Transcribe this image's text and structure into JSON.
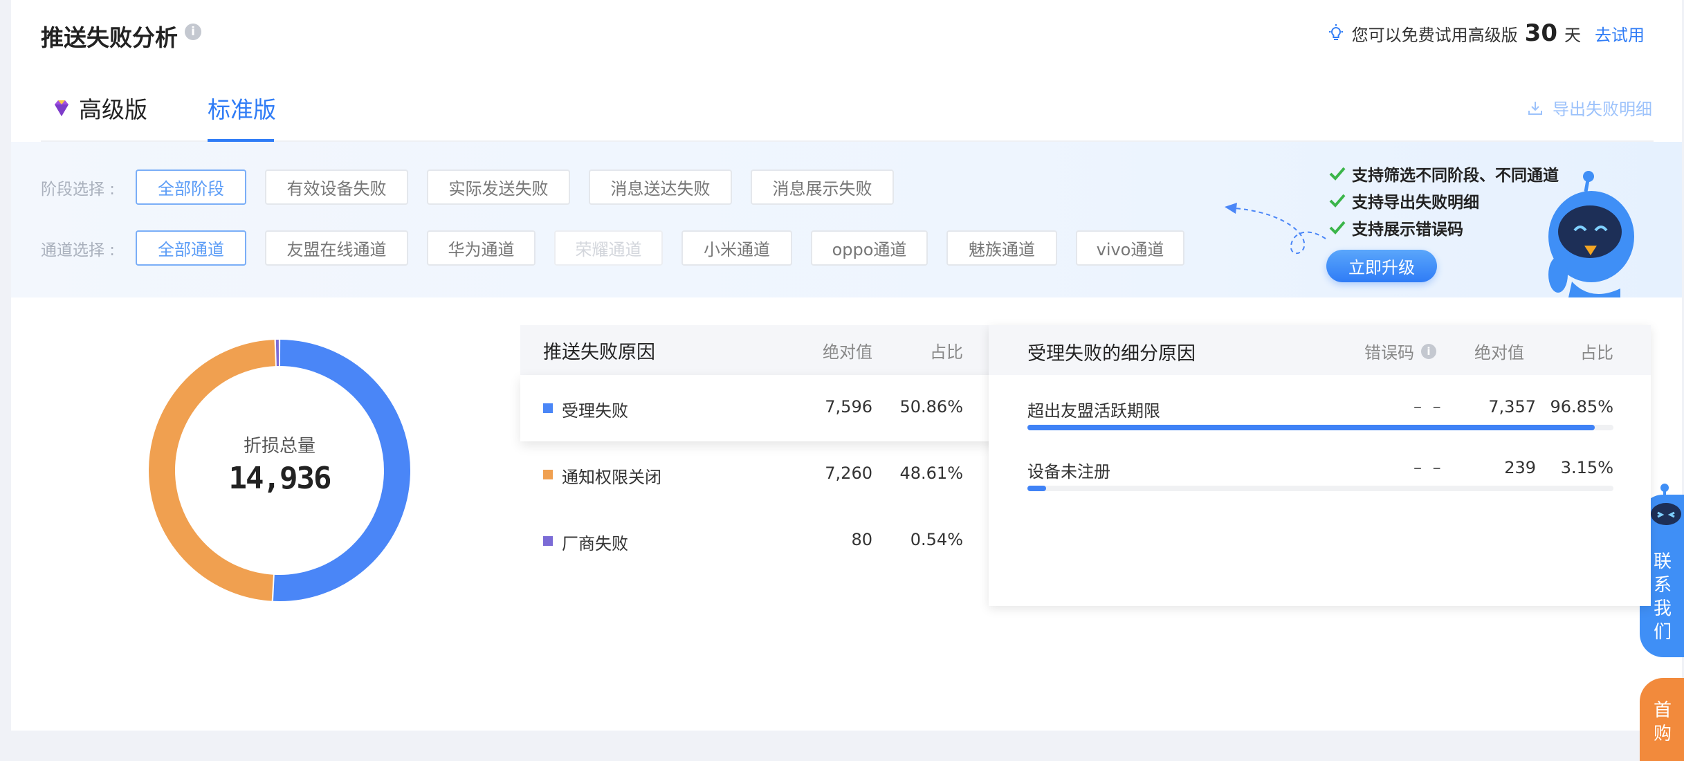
{
  "header": {
    "title": "推送失败分析",
    "trial_text": "您可以免费试用高级版",
    "trial_days": "30",
    "trial_unit": "天",
    "trial_link": "去试用"
  },
  "tabs": [
    {
      "label": "高级版",
      "active": false
    },
    {
      "label": "标准版",
      "active": true
    }
  ],
  "export_label": "导出失败明细",
  "filters": {
    "stage_label": "阶段选择 :",
    "stages": [
      "全部阶段",
      "有效设备失败",
      "实际发送失败",
      "消息送达失败",
      "消息展示失败"
    ],
    "channel_label": "通道选择 :",
    "channels": [
      "全部通道",
      "友盟在线通道",
      "华为通道",
      "荣耀通道",
      "小米通道",
      "oppo通道",
      "魅族通道",
      "vivo通道"
    ]
  },
  "promo": {
    "perks": [
      "支持筛选不同阶段、不同通道",
      "支持导出失败明细",
      "支持展示错误码"
    ],
    "upgrade_button": "立即升级"
  },
  "donut": {
    "label": "折损总量",
    "total": "14,936"
  },
  "chart_data": {
    "type": "pie",
    "title": "折损总量",
    "total": 14936,
    "slices": [
      {
        "name": "受理失败",
        "value": 7596,
        "percent": 50.86,
        "color": "#4a86f7"
      },
      {
        "name": "通知权限关闭",
        "value": 7260,
        "percent": 48.61,
        "color": "#f0a050"
      },
      {
        "name": "厂商失败",
        "value": 80,
        "percent": 0.54,
        "color": "#7b6bd6"
      }
    ]
  },
  "reasons_table": {
    "headers": [
      "推送失败原因",
      "绝对值",
      "占比"
    ],
    "rows": [
      {
        "name": "受理失败",
        "value": "7,596",
        "percent": "50.86%",
        "color": "#4a86f7",
        "selected": true
      },
      {
        "name": "通知权限关闭",
        "value": "7,260",
        "percent": "48.61%",
        "color": "#f0a050",
        "selected": false
      },
      {
        "name": "厂商失败",
        "value": "80",
        "percent": "0.54%",
        "color": "#7b6bd6",
        "selected": false
      }
    ]
  },
  "detail_table": {
    "headers": [
      "受理失败的细分原因",
      "错误码",
      "绝对值",
      "占比"
    ],
    "rows": [
      {
        "name": "超出友盟活跃期限",
        "code": "– –",
        "value": "7,357",
        "percent": "96.85%",
        "share": 0.9685
      },
      {
        "name": "设备未注册",
        "code": "– –",
        "value": "239",
        "percent": "3.15%",
        "share": 0.0315
      }
    ]
  },
  "side": {
    "contact": "联系我们",
    "home": "首购"
  },
  "colors": {
    "accent": "#2f7cf6",
    "success": "#3bb54a"
  }
}
